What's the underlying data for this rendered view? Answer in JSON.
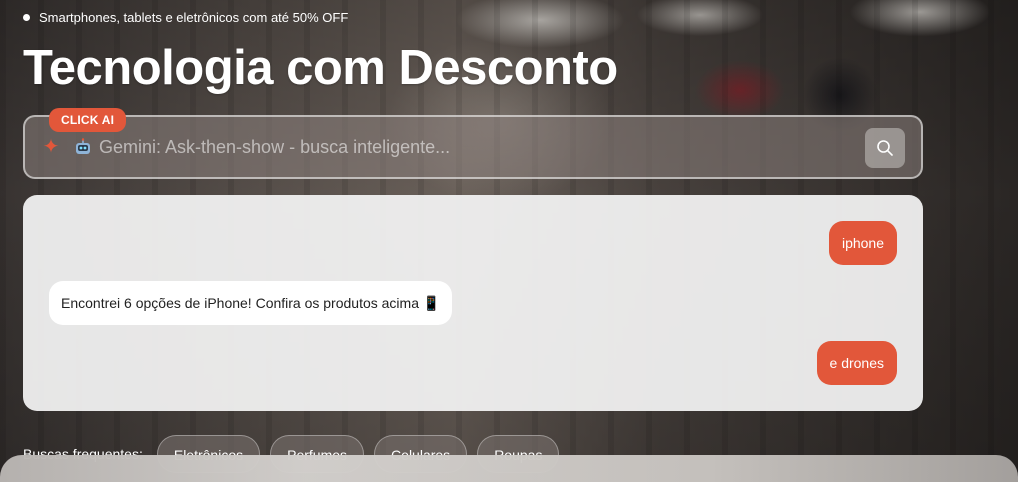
{
  "promo": {
    "text": "Smartphones, tablets e eletrônicos com até 50% OFF"
  },
  "hero": {
    "title": "Tecnologia com Desconto"
  },
  "search": {
    "badge": "CLICK AI",
    "placeholder": "Gemini: Ask-then-show - busca inteligente...",
    "robot_icon": "robot-icon",
    "spark_icon": "sparkle-icon",
    "button_icon": "search-icon"
  },
  "chat": {
    "messages": [
      {
        "role": "user",
        "text": "iphone"
      },
      {
        "role": "assistant",
        "text": "Encontrei 6 opções de iPhone! Confira os produtos acima 📱"
      },
      {
        "role": "user",
        "text": "e drones"
      }
    ]
  },
  "frequent": {
    "label": "Buscas frequentes:",
    "chips": [
      "Eletrônicos",
      "Perfumes",
      "Celulares",
      "Roupas"
    ]
  },
  "colors": {
    "accent": "#e2573a",
    "chat_bg": "#f2f2f2"
  }
}
